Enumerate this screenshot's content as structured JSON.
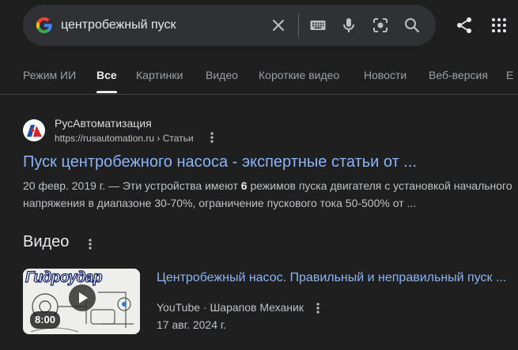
{
  "search": {
    "query": "центробежный пуск"
  },
  "tabs": [
    {
      "label": "Режим ИИ",
      "active": false
    },
    {
      "label": "Все",
      "active": true
    },
    {
      "label": "Картинки",
      "active": false
    },
    {
      "label": "Видео",
      "active": false
    },
    {
      "label": "Короткие видео",
      "active": false
    },
    {
      "label": "Новости",
      "active": false
    },
    {
      "label": "Веб-версия",
      "active": false
    },
    {
      "label": "Е",
      "active": false
    }
  ],
  "result": {
    "site_name": "РусАвтоматизация",
    "url": "https://rusautomation.ru › Статьи",
    "title": "Пуск центробежного насоса - экспертные статьи от ...",
    "snippet_pre": "20 февр. 2019 г. — Эти устройства имеют ",
    "snippet_bold": "6",
    "snippet_post": " режимов пуска двигателя с установкой начального напряжения в диапазоне 30-70%, ограничение пускового тока 50-500% от ..."
  },
  "videos": {
    "heading": "Видео",
    "items": [
      {
        "thumb_text": "Гидроудар",
        "duration": "8:00",
        "title": "Центробежный насос. Правильный и неправильный пуск ...",
        "source": "YouTube · Шарапов Механик",
        "date": "17 авг. 2024 г."
      }
    ]
  },
  "colors": {
    "background": "#1f1f1f",
    "searchbar": "#303134",
    "link": "#8ab4f8",
    "text": "#e8eaed",
    "muted": "#9aa0a6"
  },
  "icons": {
    "logo": "google-g-icon",
    "clear": "close-icon",
    "keyboard": "keyboard-icon",
    "voice": "microphone-icon",
    "lens": "lens-icon",
    "search": "search-icon",
    "share": "share-icon",
    "apps": "apps-grid-icon",
    "more": "more-vert-icon",
    "play": "play-icon"
  }
}
